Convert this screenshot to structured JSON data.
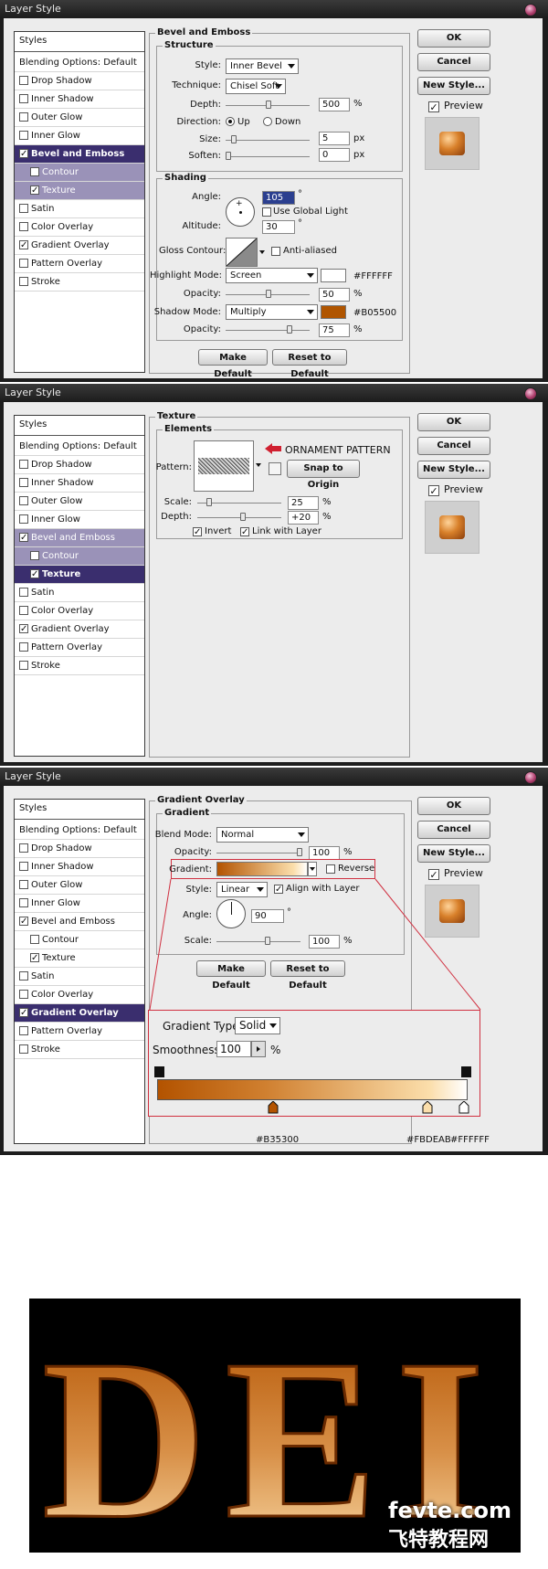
{
  "dialogs": [
    {
      "title": "Layer Style",
      "styles": [
        {
          "label": "Styles",
          "kind": "hdr"
        },
        {
          "label": "Blending Options: Default",
          "kind": "blend"
        },
        {
          "label": "Drop Shadow",
          "checked": false
        },
        {
          "label": "Inner Shadow",
          "checked": false
        },
        {
          "label": "Outer Glow",
          "checked": false
        },
        {
          "label": "Inner Glow",
          "checked": false
        },
        {
          "label": "Bevel and Emboss",
          "checked": true,
          "selected": true
        },
        {
          "label": "Contour",
          "checked": false,
          "sub": true,
          "subsel": true
        },
        {
          "label": "Texture",
          "checked": true,
          "sub": true,
          "subsel": true
        },
        {
          "label": "Satin",
          "checked": false
        },
        {
          "label": "Color Overlay",
          "checked": false
        },
        {
          "label": "Gradient Overlay",
          "checked": true
        },
        {
          "label": "Pattern Overlay",
          "checked": false
        },
        {
          "label": "Stroke",
          "checked": false
        }
      ]
    },
    {
      "title": "Layer Style",
      "styles": [
        {
          "label": "Styles",
          "kind": "hdr"
        },
        {
          "label": "Blending Options: Default",
          "kind": "blend"
        },
        {
          "label": "Drop Shadow",
          "checked": false
        },
        {
          "label": "Inner Shadow",
          "checked": false
        },
        {
          "label": "Outer Glow",
          "checked": false
        },
        {
          "label": "Inner Glow",
          "checked": false
        },
        {
          "label": "Bevel and Emboss",
          "checked": true,
          "subsel": true
        },
        {
          "label": "Contour",
          "checked": false,
          "sub": true,
          "subsel": true
        },
        {
          "label": "Texture",
          "checked": true,
          "sub": true,
          "selected": true
        },
        {
          "label": "Satin",
          "checked": false
        },
        {
          "label": "Color Overlay",
          "checked": false
        },
        {
          "label": "Gradient Overlay",
          "checked": true
        },
        {
          "label": "Pattern Overlay",
          "checked": false
        },
        {
          "label": "Stroke",
          "checked": false
        }
      ]
    },
    {
      "title": "Layer Style",
      "styles": [
        {
          "label": "Styles",
          "kind": "hdr"
        },
        {
          "label": "Blending Options: Default",
          "kind": "blend"
        },
        {
          "label": "Drop Shadow",
          "checked": false
        },
        {
          "label": "Inner Shadow",
          "checked": false
        },
        {
          "label": "Outer Glow",
          "checked": false
        },
        {
          "label": "Inner Glow",
          "checked": false
        },
        {
          "label": "Bevel and Emboss",
          "checked": true
        },
        {
          "label": "Contour",
          "checked": false,
          "sub": true
        },
        {
          "label": "Texture",
          "checked": true,
          "sub": true
        },
        {
          "label": "Satin",
          "checked": false
        },
        {
          "label": "Color Overlay",
          "checked": false
        },
        {
          "label": "Gradient Overlay",
          "checked": true,
          "selected": true
        },
        {
          "label": "Pattern Overlay",
          "checked": false
        },
        {
          "label": "Stroke",
          "checked": false
        }
      ]
    }
  ],
  "buttons": {
    "ok": "OK",
    "cancel": "Cancel",
    "new_style": "New Style...",
    "preview": "Preview",
    "make_default": "Make Default",
    "reset_default": "Reset to Default"
  },
  "bevel": {
    "section": "Bevel and Emboss",
    "structure": "Structure",
    "style_label": "Style:",
    "style_value": "Inner Bevel",
    "technique_label": "Technique:",
    "technique_value": "Chisel Soft",
    "depth_label": "Depth:",
    "depth_value": "500",
    "pct": "%",
    "direction_label": "Direction:",
    "up": "Up",
    "down": "Down",
    "size_label": "Size:",
    "size_value": "5",
    "px": "px",
    "soften_label": "Soften:",
    "soften_value": "0",
    "shading": "Shading",
    "angle_label": "Angle:",
    "angle_value": "105",
    "deg": "°",
    "global_light": "Use Global Light",
    "altitude_label": "Altitude:",
    "altitude_value": "30",
    "gloss_label": "Gloss Contour:",
    "anti_aliased": "Anti-aliased",
    "highlight_label": "Highlight Mode:",
    "highlight_value": "Screen",
    "highlight_hex": "#FFFFFF",
    "opacity_label": "Opacity:",
    "highlight_opacity": "50",
    "shadow_label": "Shadow Mode:",
    "shadow_value": "Multiply",
    "shadow_hex": "#B05500",
    "shadow_opacity": "75",
    "shadow_color": "#B05500"
  },
  "texture": {
    "section": "Texture",
    "elements": "Elements",
    "pattern_label": "Pattern:",
    "callout": "ORNAMENT PATTERN",
    "snap": "Snap to Origin",
    "scale_label": "Scale:",
    "scale_value": "25",
    "pct": "%",
    "depth_label": "Depth:",
    "depth_value": "+20",
    "invert": "Invert",
    "link": "Link with Layer"
  },
  "gradient": {
    "section": "Gradient Overlay",
    "group": "Gradient",
    "blend_label": "Blend Mode:",
    "blend_value": "Normal",
    "opacity_label": "Opacity:",
    "opacity_value": "100",
    "pct": "%",
    "gradient_label": "Gradient:",
    "reverse": "Reverse",
    "style_label": "Style:",
    "style_value": "Linear",
    "align": "Align with Layer",
    "angle_label": "Angle:",
    "angle_value": "90",
    "deg": "°",
    "scale_label": "Scale:",
    "scale_value": "100",
    "type_label": "Gradient Type:",
    "type_value": "Solid",
    "smooth_label": "Smoothness:",
    "smooth_value": "100",
    "stop1_hex": "#B35300",
    "stop2_hex": "#FBDEAB",
    "stop3_hex": "#FFFFFF",
    "color_start": "#B35300",
    "color_mid": "#FBDEAB",
    "color_end": "#FFFFFF"
  },
  "artwork": {
    "letters": "DEI",
    "watermark": "fevte.com",
    "watermark_cn": "飞特教程网"
  }
}
